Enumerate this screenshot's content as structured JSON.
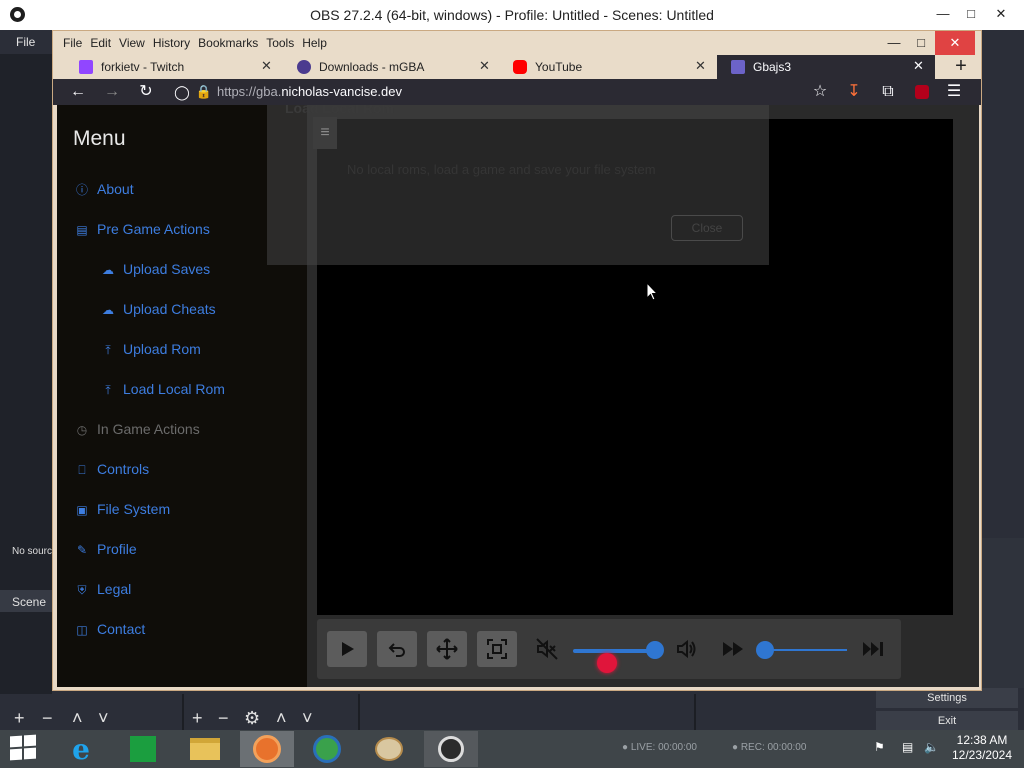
{
  "obs": {
    "window_title": "OBS 27.2.4 (64-bit, windows) - Profile: Untitled - Scenes: Untitled",
    "menu_file": "File",
    "no_source_label": "No source selected",
    "scenes_dock_title": "Scene",
    "settings_button": "Settings",
    "exit_button": "Exit",
    "status_live": "LIVE: 00:00:00",
    "status_rec": "REC: 00:00:00"
  },
  "firefox": {
    "menu": [
      "File",
      "Edit",
      "View",
      "History",
      "Bookmarks",
      "Tools",
      "Help"
    ],
    "tabs": [
      {
        "label": "forkietv - Twitch",
        "favicon_color": "#9146ff"
      },
      {
        "label": "Downloads - mGBA",
        "favicon_color": "#4b3b8f"
      },
      {
        "label": "YouTube",
        "favicon_color": "#ff0000"
      },
      {
        "label": "Gbajs3",
        "favicon_color": "#6c63c8"
      }
    ],
    "url_scheme": "https://gba.",
    "url_host": "nicholas-vancise.dev"
  },
  "page": {
    "menu_title": "Menu",
    "menu_items": [
      {
        "label": "About",
        "icon": "info-icon",
        "indent": false,
        "disabled": false
      },
      {
        "label": "Pre Game Actions",
        "icon": "folder-icon",
        "indent": false,
        "disabled": false
      },
      {
        "label": "Upload Saves",
        "icon": "cloud-upload-icon",
        "indent": true,
        "disabled": false
      },
      {
        "label": "Upload Cheats",
        "icon": "cloud-upload-icon",
        "indent": true,
        "disabled": false
      },
      {
        "label": "Upload Rom",
        "icon": "upload-icon",
        "indent": true,
        "disabled": false
      },
      {
        "label": "Load Local Rom",
        "icon": "upload-icon",
        "indent": true,
        "disabled": false
      },
      {
        "label": "In Game Actions",
        "icon": "timer-icon",
        "indent": false,
        "disabled": true
      },
      {
        "label": "Controls",
        "icon": "gamepad-icon",
        "indent": false,
        "disabled": false
      },
      {
        "label": "File System",
        "icon": "file-search-icon",
        "indent": false,
        "disabled": false
      },
      {
        "label": "Profile",
        "icon": "profile-icon",
        "indent": false,
        "disabled": false
      },
      {
        "label": "Legal",
        "icon": "shield-icon",
        "indent": false,
        "disabled": false
      },
      {
        "label": "Contact",
        "icon": "chat-icon",
        "indent": false,
        "disabled": false
      }
    ],
    "modal": {
      "title": "Load Local Rom",
      "message": "No local roms, load a game and save your file system",
      "close_label": "Close"
    },
    "volume_level": 0.95,
    "speed_level": 0.05
  },
  "taskbar": {
    "time": "12:38 AM",
    "date": "12/23/2024"
  }
}
